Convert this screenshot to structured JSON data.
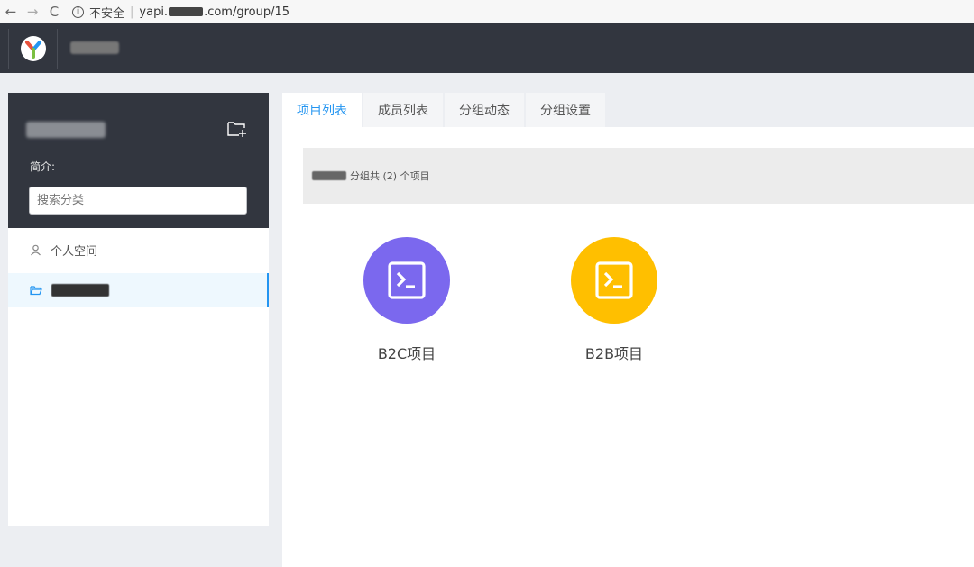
{
  "browser": {
    "back_icon": "←",
    "forward_icon": "→",
    "reload_icon": "C",
    "info_icon": "i",
    "security_label": "不安全",
    "separator": "|",
    "url_prefix": "yapi.",
    "url_suffix": ".com/group/15"
  },
  "sidebar": {
    "description_label": "简介:",
    "search_placeholder": "搜索分类",
    "personal_space_label": "个人空间"
  },
  "tabs": [
    {
      "label": "项目列表",
      "active": true
    },
    {
      "label": "成员列表",
      "active": false
    },
    {
      "label": "分组动态",
      "active": false
    },
    {
      "label": "分组设置",
      "active": false
    }
  ],
  "summary": {
    "text": "分组共 (2) 个项目"
  },
  "projects": [
    {
      "name": "B2C项目",
      "color": "#7b68ee"
    },
    {
      "name": "B2B项目",
      "color": "#ffbf00"
    }
  ],
  "colors": {
    "header_bg": "#32363f",
    "accent": "#2395f1"
  },
  "icons": {
    "logo": "yapi-logo-icon",
    "add_group": "folder-add-icon",
    "personal_space": "user-icon",
    "group_item": "folder-open-icon",
    "project": "terminal-icon"
  }
}
